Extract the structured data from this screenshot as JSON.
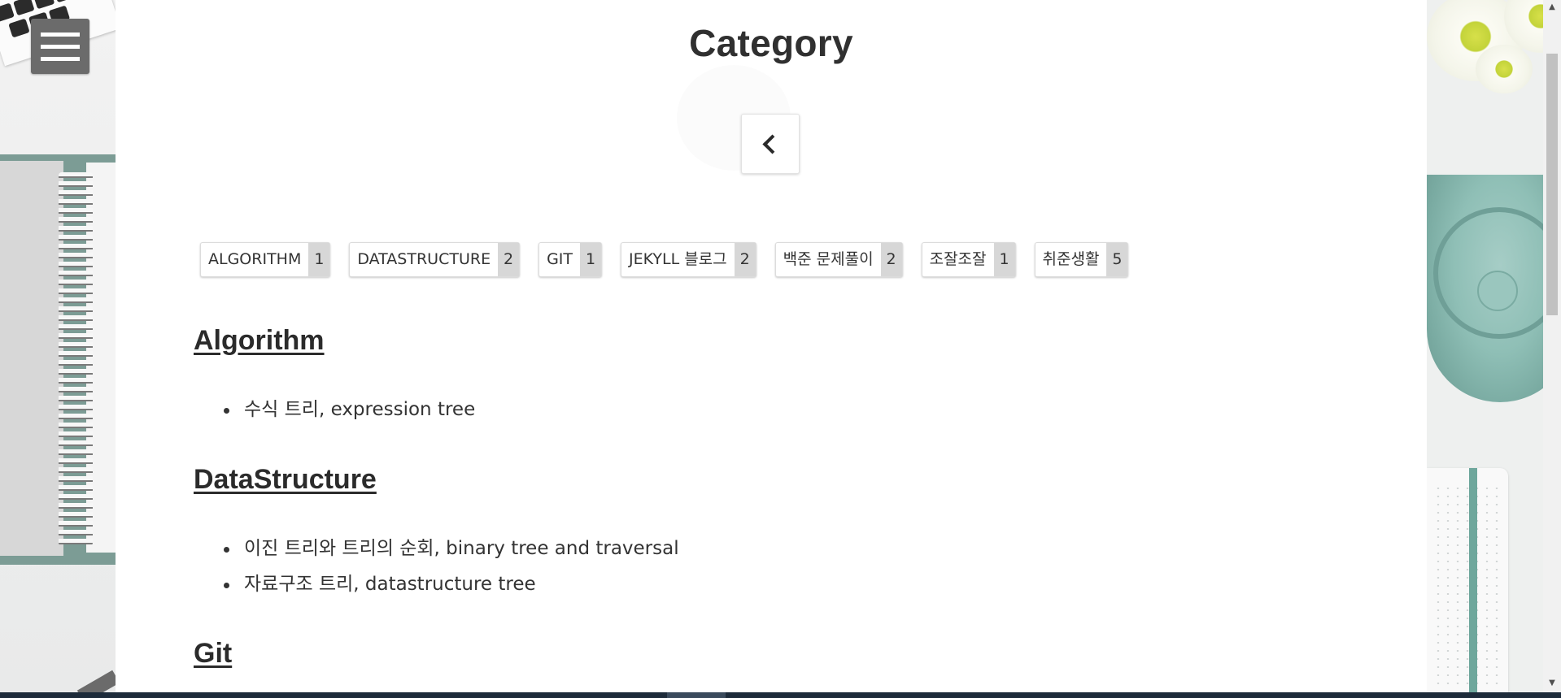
{
  "page": {
    "title": "Category",
    "back_icon": "chevron-left-icon",
    "menu_icon": "hamburger-menu-icon"
  },
  "tags": [
    {
      "name": "ALGORITHM",
      "count": "1"
    },
    {
      "name": "DATASTRUCTURE",
      "count": "2"
    },
    {
      "name": "GIT",
      "count": "1"
    },
    {
      "name": "JEKYLL 블로그",
      "count": "2"
    },
    {
      "name": "백준 문제풀이",
      "count": "2"
    },
    {
      "name": "조잘조잘",
      "count": "1"
    },
    {
      "name": "취준생활",
      "count": "5"
    }
  ],
  "sections": [
    {
      "heading": "Algorithm",
      "posts": [
        "수식 트리, expression tree"
      ]
    },
    {
      "heading": "DataStructure",
      "posts": [
        "이진 트리와 트리의 순회, binary tree and traversal",
        "자료구조 트리, datastructure tree"
      ]
    },
    {
      "heading": "Git",
      "posts": []
    }
  ],
  "colors": {
    "panel": "#ffffff",
    "text": "#333333",
    "tag_count_bg": "#d7d7d7",
    "menu_button": "#6b6b6b"
  }
}
